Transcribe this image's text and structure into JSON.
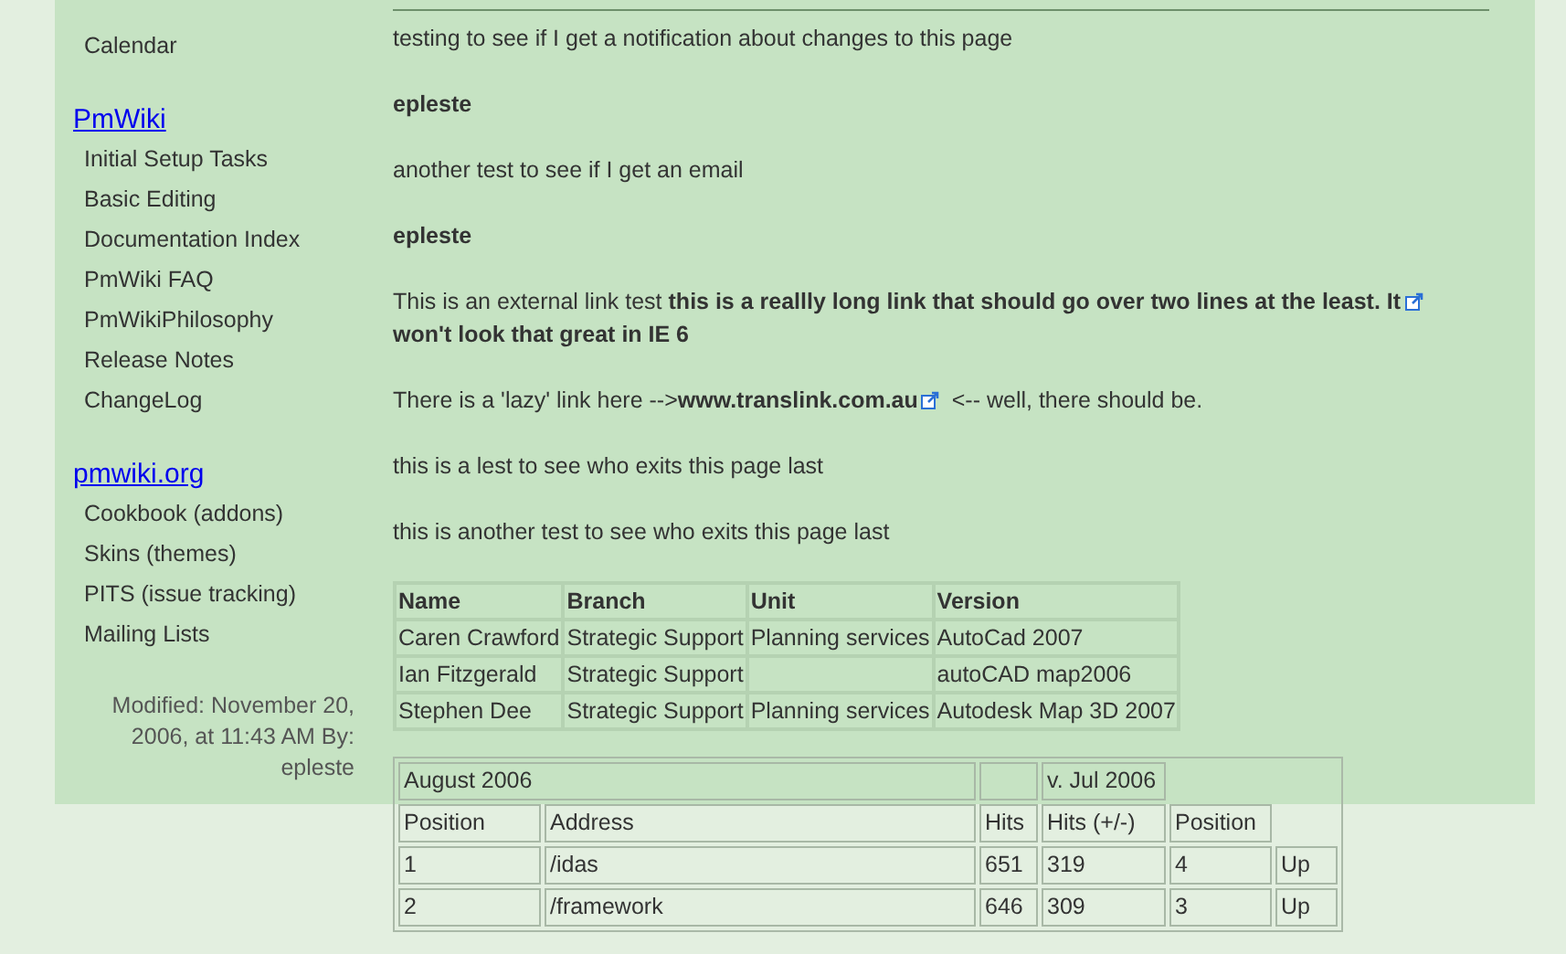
{
  "sidebar": {
    "groups": [
      {
        "items": [
          "Calendar"
        ]
      },
      {
        "heading": "PmWiki",
        "items": [
          "Initial Setup Tasks",
          "Basic Editing",
          "Documentation Index",
          "PmWiki FAQ",
          "PmWikiPhilosophy",
          "Release Notes",
          "ChangeLog"
        ]
      },
      {
        "heading": "pmwiki.org",
        "items": [
          "Cookbook (addons)",
          "Skins (themes)",
          "PITS (issue tracking)",
          "Mailing Lists"
        ]
      }
    ],
    "modified": "Modified: November 20, 2006, at 11:43 AM By: epleste"
  },
  "content": {
    "paragraphs": [
      {
        "parts": [
          {
            "kind": "text",
            "text": "testing to see if I get a notification about changes to this page"
          }
        ]
      },
      {
        "parts": [
          {
            "kind": "author",
            "text": "epleste"
          }
        ]
      },
      {
        "parts": [
          {
            "kind": "text",
            "text": "another test to see if I get an email"
          }
        ]
      },
      {
        "parts": [
          {
            "kind": "author",
            "text": "epleste"
          }
        ]
      },
      {
        "parts": [
          {
            "kind": "text",
            "text": "This is an external link test "
          },
          {
            "kind": "wrapped_link",
            "lines": [
              "this is a reallly long link that should go over two lines at the least. It",
              "won't look that great in IE 6"
            ]
          }
        ]
      },
      {
        "parts": [
          {
            "kind": "text",
            "text": "There is a 'lazy' link here -->"
          },
          {
            "kind": "link",
            "text": "www.translink.com.au"
          },
          {
            "kind": "text",
            "text": " <-- well, there should be."
          }
        ]
      },
      {
        "parts": [
          {
            "kind": "text",
            "text": "this is a lest to see who exits this page last"
          }
        ]
      },
      {
        "parts": [
          {
            "kind": "text",
            "text": "this is another test to see who exits this page last"
          }
        ]
      }
    ],
    "software_table": {
      "columns": [
        "Name",
        "Branch",
        "Unit",
        "Version"
      ],
      "rows": [
        [
          "Caren Crawford",
          "Strategic Support",
          "Planning services",
          "AutoCad 2007"
        ],
        [
          "Ian Fitzgerald",
          "Strategic Support",
          "",
          "autoCAD map2006"
        ],
        [
          "Stephen Dee",
          "Strategic Support",
          "Planning services",
          "Autodesk Map 3D 2007"
        ]
      ]
    },
    "stats_table": {
      "groups": [
        {
          "kind": "wide",
          "label": "August 2006"
        },
        {
          "kind": "blank"
        },
        {
          "kind": "single",
          "label": "v. Jul 2006"
        }
      ],
      "columns": [
        "Position",
        "Address",
        "Hits",
        "Hits (+/-)",
        "Position"
      ],
      "rows": [
        [
          "1",
          "/idas",
          "651",
          "319",
          "4",
          "Up"
        ],
        [
          "2",
          "/framework",
          "646",
          "309",
          "3",
          "Up"
        ]
      ]
    }
  }
}
